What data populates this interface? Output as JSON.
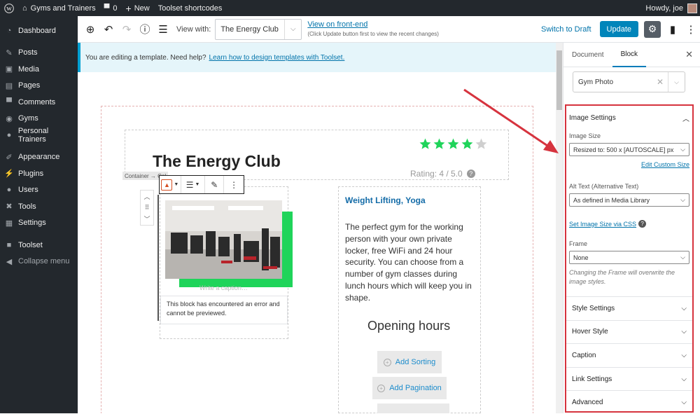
{
  "adminbar": {
    "site_name": "Gyms and Trainers",
    "comments_count": "0",
    "new_label": "New",
    "shortcodes_label": "Toolset shortcodes",
    "howdy": "Howdy, joe"
  },
  "sidebar": {
    "items": [
      {
        "label": "Dashboard",
        "icon": "dashboard-icon"
      },
      {
        "label": "Posts",
        "icon": "pin-icon"
      },
      {
        "label": "Media",
        "icon": "media-icon"
      },
      {
        "label": "Pages",
        "icon": "page-icon"
      },
      {
        "label": "Comments",
        "icon": "comment-icon"
      },
      {
        "label": "Gyms",
        "icon": "gym-icon"
      },
      {
        "label": "Personal Trainers",
        "icon": "person-icon"
      },
      {
        "label": "Appearance",
        "icon": "brush-icon"
      },
      {
        "label": "Plugins",
        "icon": "plugin-icon"
      },
      {
        "label": "Users",
        "icon": "users-icon"
      },
      {
        "label": "Tools",
        "icon": "wrench-icon"
      },
      {
        "label": "Settings",
        "icon": "settings-icon"
      },
      {
        "label": "Toolset",
        "icon": "toolset-icon"
      }
    ],
    "collapse_label": "Collapse menu"
  },
  "toolbar": {
    "view_with_label": "View with:",
    "view_with_value": "The Energy Club",
    "view_frontend": "View on front-end",
    "view_note": "(Click Update button first to view the recent changes)",
    "switch_draft": "Switch to Draft",
    "update": "Update"
  },
  "notice": {
    "text": "You are editing a template. Need help?",
    "link": "Learn how to design templates with Toolset."
  },
  "canvas": {
    "title": "The Energy Club",
    "rating_text": "Rating: 4 / 5.0",
    "stars_value": 4,
    "stars_max": 5,
    "crumb": "Container → Col",
    "caption_placeholder": "Write a caption…",
    "error_text": "This block has encountered an error and cannot be previewed.",
    "right_heading": "Weight Lifting, Yoga",
    "right_body": "The perfect gym for the working person with your own private locker, free WiFi and 24 hour security. You can choose from a number of gym classes during lunch hours which will keep you in shape.",
    "opening_hours": "Opening hours",
    "add_sorting": "Add Sorting",
    "add_pagination": "Add Pagination"
  },
  "inspector": {
    "tab_document": "Document",
    "tab_block": "Block",
    "gym_select": "Gym Photo",
    "image_settings_title": "Image Settings",
    "image_size_label": "Image Size",
    "image_size_value": "Resized to: 500 x [AUTOSCALE] px",
    "edit_custom_size": "Edit Custom Size",
    "alt_text_label": "Alt Text (Alternative Text)",
    "alt_text_value": "As defined in Media Library",
    "set_image_css": "Set Image Size via CSS",
    "frame_label": "Frame",
    "frame_value": "None",
    "frame_note": "Changing the Frame will overwrite the image styles.",
    "sections": [
      "Style Settings",
      "Hover Style",
      "Caption",
      "Link Settings",
      "Advanced"
    ]
  },
  "colors": {
    "accent": "#0085ba",
    "highlight": "#d6333e",
    "star": "#1fd45a"
  }
}
